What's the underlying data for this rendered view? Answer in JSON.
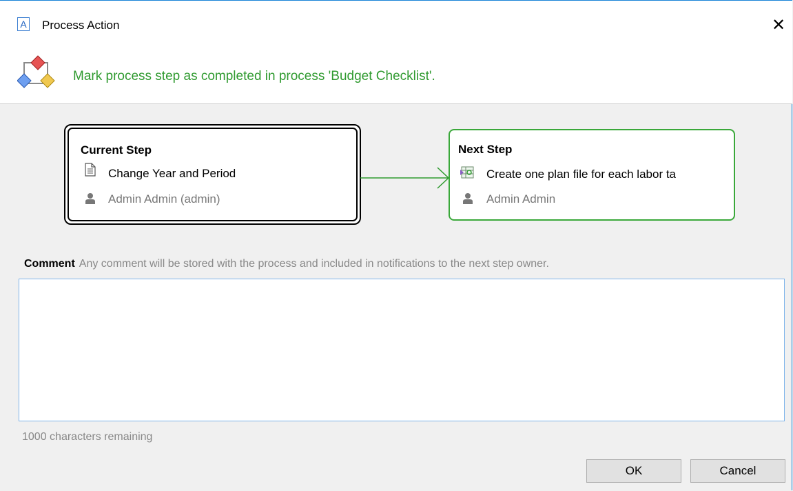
{
  "window": {
    "title": "Process Action",
    "app_icon_letter": "A",
    "close_symbol": "✕"
  },
  "header": {
    "message": "Mark process step as completed in process 'Budget Checklist'.",
    "message_color": "#2f9a2f",
    "icon": "process-icon"
  },
  "current_step": {
    "title": "Current Step",
    "task": "Change Year and Period",
    "task_icon": "document-icon",
    "owner": "Admin Admin (admin)",
    "owner_icon": "user-icon"
  },
  "next_step": {
    "title": "Next Step",
    "task": "Create one plan file for each labor ta",
    "task_icon": "plan-file-icon",
    "owner": "Admin Admin",
    "owner_icon": "user-icon",
    "border_color": "#3aa83a"
  },
  "comment": {
    "label": "Comment",
    "hint": "Any comment will be stored with the process and included in notifications to the next step owner.",
    "value": "",
    "chars_remaining": "1000 characters remaining"
  },
  "buttons": {
    "ok": "OK",
    "cancel": "Cancel"
  }
}
